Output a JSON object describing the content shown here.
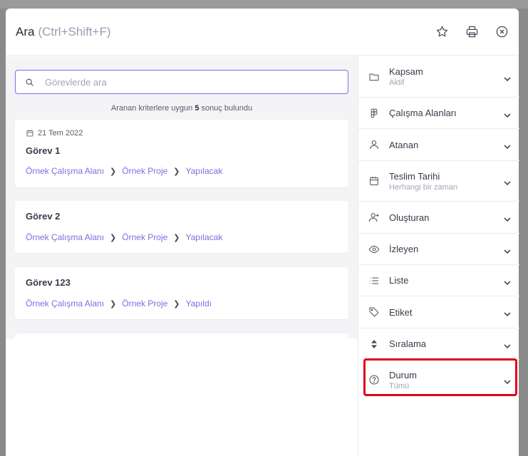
{
  "header": {
    "title": "Ara",
    "shortcut": "(Ctrl+Shift+F)"
  },
  "search": {
    "placeholder": "Görevlerde ara",
    "value": ""
  },
  "result_summary": {
    "prefix": "Aranan kriterlere uygun",
    "count": "5",
    "suffix": "sonuç bulundu"
  },
  "results": [
    {
      "date": "21 Tem 2022",
      "title": "Görev 1",
      "workspace": "Örnek Çalışma Alanı",
      "project": "Örnek Proje",
      "list": "Yapılacak"
    },
    {
      "date": "",
      "title": "Görev 2",
      "workspace": "Örnek Çalışma Alanı",
      "project": "Örnek Proje",
      "list": "Yapılacak"
    },
    {
      "date": "",
      "title": "Görev 123",
      "workspace": "Örnek Çalışma Alanı",
      "project": "Örnek Proje",
      "list": "Yapıldı"
    }
  ],
  "filters": [
    {
      "label": "Kapsam",
      "sub": "Aktif",
      "icon": "folder-icon"
    },
    {
      "label": "Çalışma Alanları",
      "sub": "",
      "icon": "workspace-icon"
    },
    {
      "label": "Atanan",
      "sub": "",
      "icon": "user-icon"
    },
    {
      "label": "Teslim Tarihi",
      "sub": "Herhangi bir zaman",
      "icon": "calendar-icon"
    },
    {
      "label": "Oluşturan",
      "sub": "",
      "icon": "user-plus-icon"
    },
    {
      "label": "İzleyen",
      "sub": "",
      "icon": "eye-icon"
    },
    {
      "label": "Liste",
      "sub": "",
      "icon": "list-icon"
    },
    {
      "label": "Etiket",
      "sub": "",
      "icon": "tag-icon"
    },
    {
      "label": "Sıralama",
      "sub": "",
      "icon": "sort-icon"
    },
    {
      "label": "Durum",
      "sub": "Tümü",
      "icon": "question-circle-icon"
    }
  ],
  "colors": {
    "accent": "#7b6fe0",
    "highlight": "#e0001a"
  }
}
